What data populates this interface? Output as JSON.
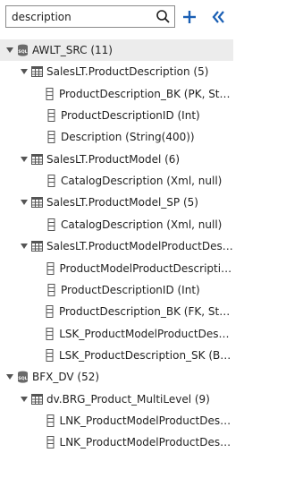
{
  "search": {
    "value": "description",
    "placeholder": ""
  },
  "toolbar": {
    "add_icon": "plus-icon",
    "collapse_icon": "double-chevron-left-icon"
  },
  "colors": {
    "accent": "#1a5fb4",
    "tree_line": "#444444",
    "icon_grey": "#6a6a6a",
    "selection": "#ececec"
  },
  "tree": {
    "nodes": [
      {
        "label": "AWLT_SRC (11)",
        "kind": "database",
        "level": 0
      },
      {
        "label": "SalesLT.ProductDescription (5)",
        "kind": "table",
        "level": 1
      },
      {
        "label": "ProductDescription_BK (PK, String(10…",
        "kind": "column",
        "level": 2
      },
      {
        "label": "ProductDescriptionID (Int)",
        "kind": "column",
        "level": 2
      },
      {
        "label": "Description (String(400))",
        "kind": "column",
        "level": 2
      },
      {
        "label": "SalesLT.ProductModel (6)",
        "kind": "table",
        "level": 1
      },
      {
        "label": "CatalogDescription (Xml, null)",
        "kind": "column",
        "level": 2
      },
      {
        "label": "SalesLT.ProductModel_SP (5)",
        "kind": "table",
        "level": 1
      },
      {
        "label": "CatalogDescription (Xml, null)",
        "kind": "column",
        "level": 2
      },
      {
        "label": "SalesLT.ProductModelProductDescripti…",
        "kind": "table",
        "level": 1
      },
      {
        "label": "ProductModelProductDescription_B…",
        "kind": "column",
        "level": 2
      },
      {
        "label": "ProductDescriptionID (Int)",
        "kind": "column",
        "level": 2
      },
      {
        "label": "ProductDescription_BK (FK, String(10…",
        "kind": "column",
        "level": 2
      },
      {
        "label": "LSK_ProductModelProductDescriptio…",
        "kind": "column",
        "level": 2
      },
      {
        "label": "LSK_ProductDescription_SK (Binary(2…",
        "kind": "column",
        "level": 2
      },
      {
        "label": "BFX_DV (52)",
        "kind": "database",
        "level": 0
      },
      {
        "label": "dv.BRG_Product_MultiLevel (9)",
        "kind": "table",
        "level": 1
      },
      {
        "label": "LNK_ProductModelProductDescripti…",
        "kind": "column",
        "level": 2
      },
      {
        "label": "LNK_ProductModelProductDescripti…",
        "kind": "column",
        "level": 2
      }
    ]
  }
}
